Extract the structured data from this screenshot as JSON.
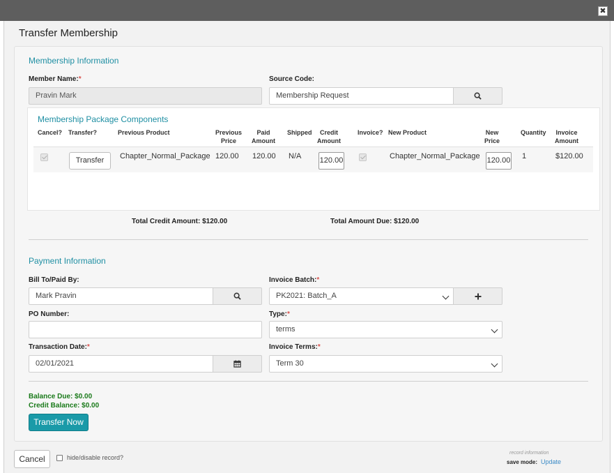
{
  "dialog": {
    "title": "Transfer Membership",
    "close_glyph": "✖"
  },
  "membership": {
    "section_title": "Membership Information",
    "member_name_label": "Member Name:",
    "member_name_value": "Pravin Mark",
    "source_code_label": "Source Code:",
    "source_code_value": "Membership Request"
  },
  "package": {
    "title": "Membership Package Components",
    "headers": {
      "cancel": "Cancel?",
      "transfer": "Transfer?",
      "previous_product": "Previous Product",
      "previous_price_1": "Previous",
      "previous_price_2": "Price",
      "paid_amount_1": "Paid",
      "paid_amount_2": "Amount",
      "shipped": "Shipped",
      "credit_amount_1": "Credit",
      "credit_amount_2": "Amount",
      "invoice": "Invoice?",
      "new_product": "New Product",
      "new_price_1": "New",
      "new_price_2": "Price",
      "quantity": "Quantity",
      "invoice_amount_1": "Invoice",
      "invoice_amount_2": "Amount"
    },
    "row": {
      "cancel_checked": true,
      "transfer_button": "Transfer",
      "previous_product": "Chapter_Normal_Package",
      "previous_price": "120.00",
      "paid_amount": "120.00",
      "shipped": "N/A",
      "credit_amount": "120.00",
      "invoice_checked": true,
      "new_product": "Chapter_Normal_Package",
      "new_price": "120.00",
      "quantity": "1",
      "invoice_amount": "$120.00"
    },
    "total_credit": "Total Credit Amount: $120.00",
    "total_due": "Total Amount Due: $120.00"
  },
  "payment": {
    "section_title": "Payment Information",
    "bill_to_label": "Bill To/Paid By:",
    "bill_to_value": "Mark Pravin",
    "invoice_batch_label": "Invoice Batch:",
    "invoice_batch_value": "PK2021: Batch_A",
    "po_number_label": "PO Number:",
    "po_number_value": "",
    "type_label": "Type:",
    "type_value": "terms",
    "transaction_date_label": "Transaction Date:",
    "transaction_date_value": "02/01/2021",
    "invoice_terms_label": "Invoice Terms:",
    "invoice_terms_value": "Term 30",
    "balance_due": "Balance Due: $0.00",
    "credit_balance": "Credit Balance: $0.00",
    "transfer_now": "Transfer Now"
  },
  "footer": {
    "cancel": "Cancel",
    "hide_label": "hide/disable record?",
    "record_info": "record information",
    "save_mode_label": "save mode:",
    "save_mode_value": "Update"
  },
  "colors": {
    "accent": "#1a9aa8",
    "section_title": "#1f8fa3",
    "required": "#d9534f",
    "balance_green": "#1a7a1a"
  }
}
